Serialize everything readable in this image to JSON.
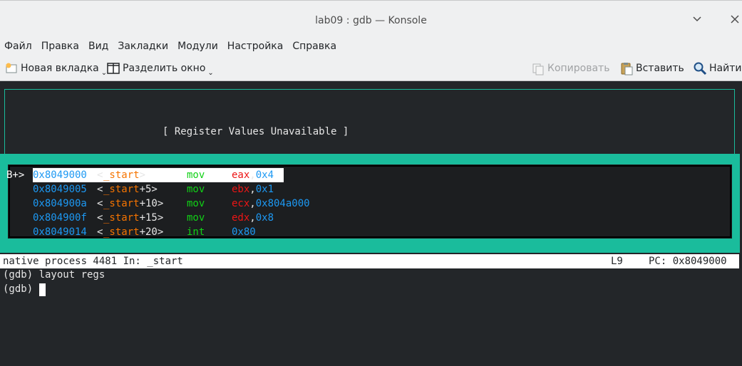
{
  "window": {
    "title": "lab09 : gdb — Konsole"
  },
  "menu": {
    "items": [
      "Файл",
      "Правка",
      "Вид",
      "Закладки",
      "Модули",
      "Настройка",
      "Справка"
    ]
  },
  "toolbar": {
    "new_tab": "Новая вкладка",
    "split_view": "Разделить окно",
    "copy": "Копировать",
    "paste": "Вставить",
    "find": "Найти"
  },
  "terminal": {
    "register_message": "[ Register Values Unavailable ]",
    "asm_rows": [
      {
        "marker": "B+>",
        "addr": "0x8049000",
        "sym_open": "<",
        "sym_name": "_start",
        "sym_close": ">",
        "op": "mov",
        "reg": "eax",
        "comma": ",",
        "arg": "0x4"
      },
      {
        "marker": "",
        "addr": "0x8049005",
        "sym_open": "<",
        "sym_name": "_start",
        "sym_close": "+5>",
        "op": "mov",
        "reg": "ebx",
        "comma": ",",
        "arg": "0x1"
      },
      {
        "marker": "",
        "addr": "0x804900a",
        "sym_open": "<",
        "sym_name": "_start",
        "sym_close": "+10>",
        "op": "mov",
        "reg": "ecx",
        "comma": ",",
        "arg": "0x804a000"
      },
      {
        "marker": "",
        "addr": "0x804900f",
        "sym_open": "<",
        "sym_name": "_start",
        "sym_close": "+15>",
        "op": "mov",
        "reg": "edx",
        "comma": ",",
        "arg": "0x8"
      },
      {
        "marker": "",
        "addr": "0x8049014",
        "sym_open": "<",
        "sym_name": "_start",
        "sym_close": "+20>",
        "op": "int",
        "reg": "",
        "comma": "",
        "arg": "0x80"
      }
    ],
    "status": {
      "process": "native process 4481 In: _start",
      "line": "L9",
      "pc": "PC: 0x8049000"
    },
    "commands": [
      "(gdb) layout regs",
      "(gdb) "
    ]
  }
}
